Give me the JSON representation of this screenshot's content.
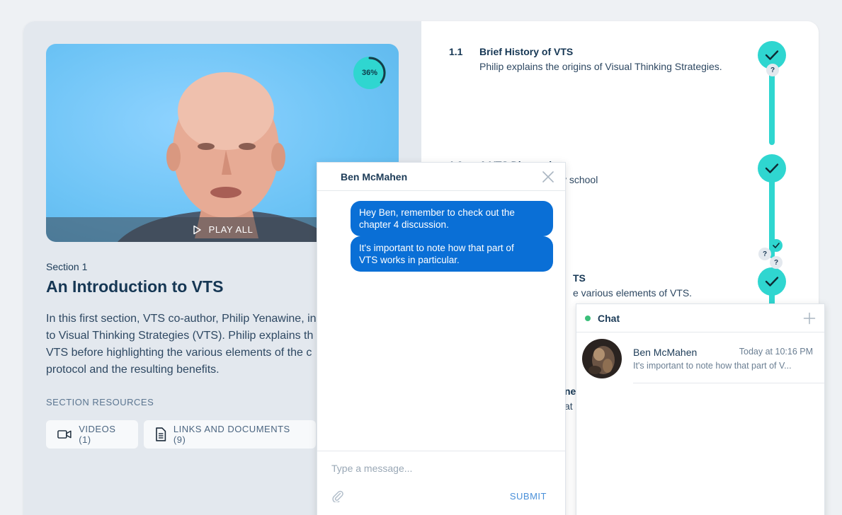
{
  "video": {
    "progress_label": "36%",
    "progress_value": 0.36,
    "play_all_label": "PLAY ALL"
  },
  "section": {
    "label": "Section 1",
    "title": "An Introduction to VTS",
    "description_lines": [
      "In this first section, VTS co-author, Philip Yenawine, in",
      "to Visual Thinking Strategies (VTS). Philip explains th",
      "VTS before highlighting the various elements of the c",
      "protocol and the resulting benefits."
    ],
    "resources_label": "SECTION RESOURCES",
    "videos_button": "VIDEOS (1)",
    "links_button": "LINKS AND DOCUMENTS (9)"
  },
  "lessons": [
    {
      "num": "1.1",
      "title": "Brief History of VTS",
      "desc": "Philip explains the origins of Visual Thinking Strategies."
    },
    {
      "num": "1.2",
      "title": "A VTS Discussion",
      "desc": "on in an elementary school"
    },
    {
      "num": "",
      "title": "TS",
      "desc": "e various elements of VTS."
    },
    {
      "num": "",
      "title": "ne",
      "desc": "at i"
    }
  ],
  "markers": {
    "question": "?"
  },
  "conversation": {
    "contact_name": "Ben McMahen",
    "messages": [
      {
        "line1": "Hey Ben, remember to check out the",
        "line2": "chapter 4 discussion."
      },
      {
        "line1": "It's important to note how that part of",
        "line2": "VTS works in particular."
      }
    ],
    "input_placeholder": "Type a message...",
    "submit_label": "SUBMIT"
  },
  "chat": {
    "title": "Chat",
    "item": {
      "name": "Ben McMahen",
      "time": "Today at 10:16 PM",
      "preview": "It's important to note how that part of V..."
    }
  },
  "colors": {
    "accent": "#2fd6d0",
    "bubble": "#0a6fd6",
    "online": "#3bbf7a"
  }
}
